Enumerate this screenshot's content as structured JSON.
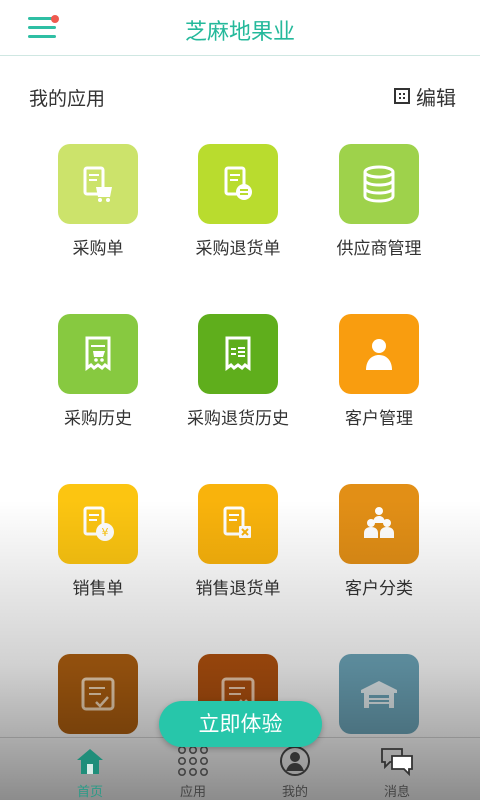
{
  "header": {
    "title": "芝麻地果业"
  },
  "section": {
    "title": "我的应用",
    "edit_label": "编辑"
  },
  "apps": [
    {
      "label": "采购单",
      "icon": "purchase-order-icon",
      "color": "#cce36b"
    },
    {
      "label": "采购退货单",
      "icon": "purchase-return-icon",
      "color": "#b9dc2e"
    },
    {
      "label": "供应商管理",
      "icon": "supplier-database-icon",
      "color": "#9ed24b"
    },
    {
      "label": "采购历史",
      "icon": "purchase-history-icon",
      "color": "#87c940"
    },
    {
      "label": "采购退货历史",
      "icon": "purchase-return-history-icon",
      "color": "#5fae1c"
    },
    {
      "label": "客户管理",
      "icon": "customer-icon",
      "color": "#f99d0f"
    },
    {
      "label": "销售单",
      "icon": "sales-order-icon",
      "color": "#fcc511"
    },
    {
      "label": "销售退货单",
      "icon": "sales-return-icon",
      "color": "#f9b30c"
    },
    {
      "label": "客户分类",
      "icon": "customer-group-icon",
      "color": "#e28f16"
    },
    {
      "label": "",
      "icon": "checklist-icon",
      "color": "#b06010"
    },
    {
      "label": "",
      "icon": "document-cancel-icon",
      "color": "#b3520f"
    },
    {
      "label": "",
      "icon": "warehouse-icon",
      "color": "#6ea7bb"
    }
  ],
  "cta": {
    "label": "立即体验"
  },
  "tabs": [
    {
      "label": "首页",
      "icon": "home-icon",
      "active": true
    },
    {
      "label": "应用",
      "icon": "grid-icon",
      "active": false
    },
    {
      "label": "我的",
      "icon": "profile-icon",
      "active": false
    },
    {
      "label": "消息",
      "icon": "message-icon",
      "active": false
    }
  ],
  "colors": {
    "accent": "#27c6aa",
    "notification_dot": "#ef5a4f"
  }
}
